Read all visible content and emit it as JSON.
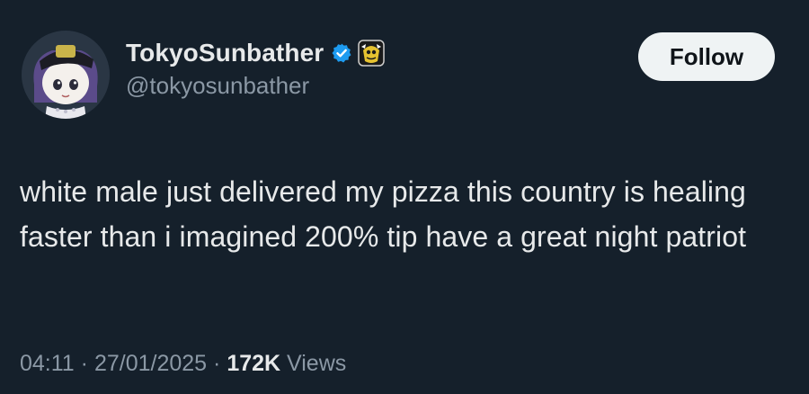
{
  "user": {
    "display_name": "TokyoSunbather",
    "handle": "@tokyosunbather",
    "verified_icon": "verified-badge-icon",
    "affiliate_icon": "affiliate-badge-icon"
  },
  "follow_button": {
    "label": "Follow"
  },
  "tweet": {
    "text": "white male just delivered my pizza this country is healing faster than i imagined 200% tip have a great night patriot"
  },
  "meta": {
    "time": "04:11",
    "separator": "·",
    "date": "27/01/2025",
    "views_count": "172K",
    "views_label": "Views"
  },
  "colors": {
    "background": "#15202b",
    "text_primary": "#e7e9ea",
    "text_secondary": "#8b98a5",
    "verified_blue": "#1d9bf0",
    "follow_bg": "#eff3f4"
  }
}
